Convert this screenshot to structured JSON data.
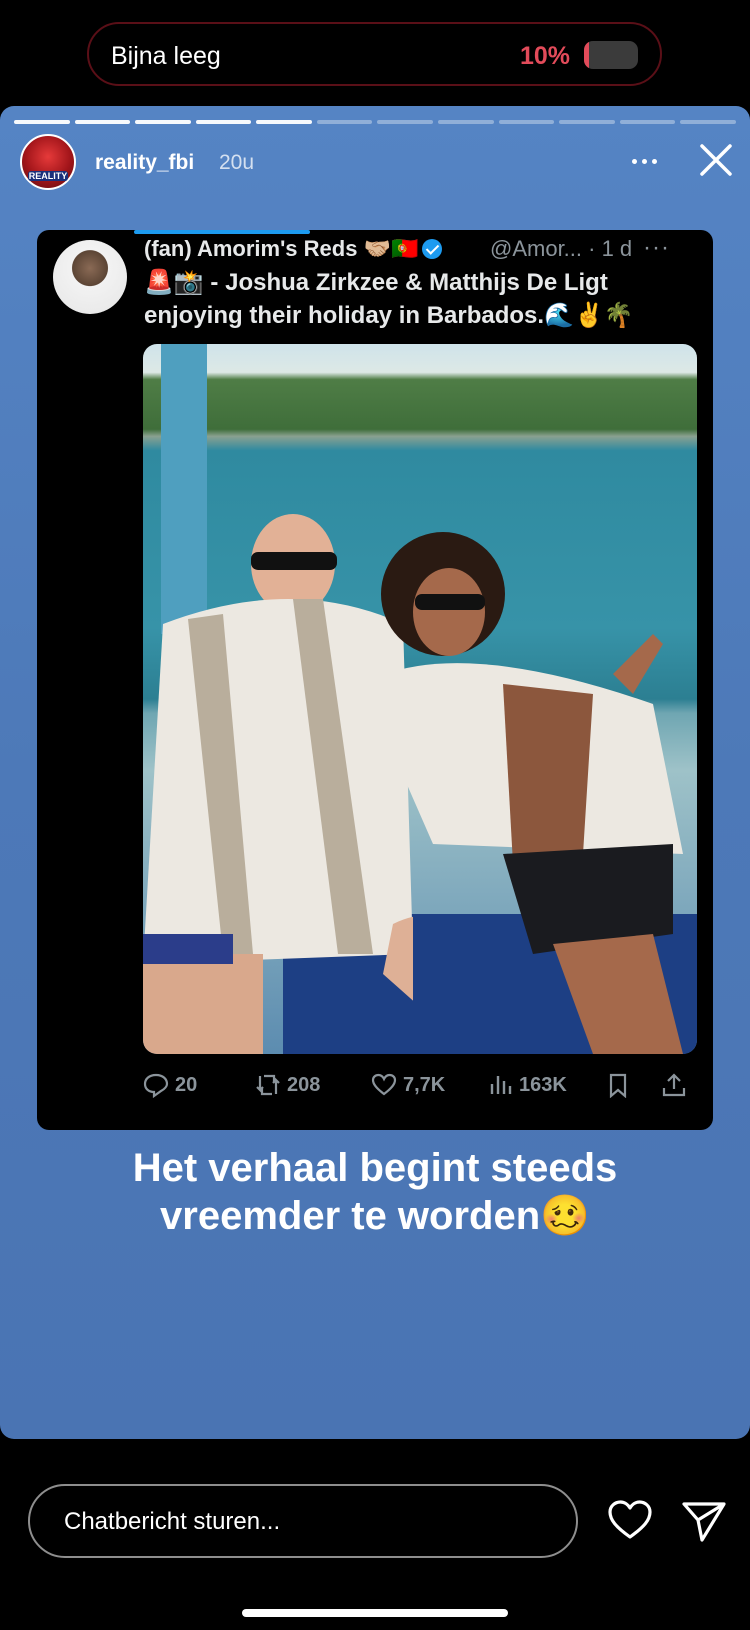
{
  "status": {
    "battery_label": "Bijna leeg",
    "battery_percent": "10%",
    "battery_level": 0.1,
    "battery_color": "#e24b5a"
  },
  "story": {
    "username": "reality_fbi",
    "time_ago": "20u",
    "avatar_text": "REALITY",
    "progress_total": 12,
    "progress_done": 5,
    "caption": "Het verhaal begint steeds vreemder te worden🥴",
    "background_color": "#4f7bbb"
  },
  "tweet": {
    "author_name": "(fan) Amorim's Reds 🤝🏼🇵🇹",
    "handle_time": "@Amor... · 1 d",
    "more": "···",
    "text": "🚨📸 - Joshua Zirkzee & Matthijs De Ligt enjoying their holiday in Barbados.🌊✌️🌴",
    "replies": "20",
    "retweets": "208",
    "likes": "7,7K",
    "views": "163K"
  },
  "footer": {
    "chat_placeholder": "Chatbericht sturen...",
    "like_icon": "heart-icon",
    "send_icon": "paper-plane-icon"
  }
}
